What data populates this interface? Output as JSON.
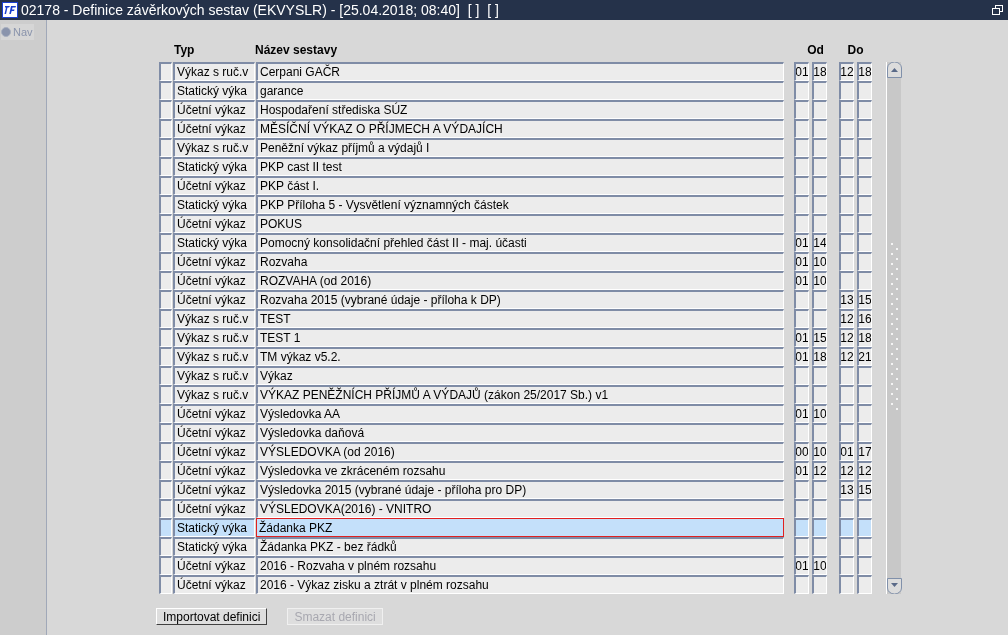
{
  "window": {
    "title": "02178 - Definice závěrkových sestav (EKVYSLR) - [25.04.2018; 08:40]  [ ]  [ ]"
  },
  "nav": {
    "label": "Nav",
    "selected": false
  },
  "table": {
    "columns": [
      "Typ",
      "Název sestavy",
      "Od",
      "Do"
    ],
    "rows": [
      {
        "type": "Výkaz s ruč.v",
        "name": "Cerpani GAČR",
        "od": [
          "01",
          "18"
        ],
        "do": [
          "12",
          "18"
        ],
        "selected": false
      },
      {
        "type": "Statický výka",
        "name": "garance",
        "selected": false
      },
      {
        "type": "Účetní výkaz",
        "name": "Hospodaření střediska SÚZ",
        "selected": false
      },
      {
        "type": "Účetní výkaz",
        "name": "MĚSÍČNÍ VÝKAZ O PŘÍJMECH A VÝDAJÍCH",
        "selected": false
      },
      {
        "type": "Výkaz s ruč.v",
        "name": "Peněžní výkaz příjmů a výdajů I",
        "selected": false
      },
      {
        "type": "Statický výka",
        "name": "PKP cast II test",
        "selected": false
      },
      {
        "type": "Účetní výkaz",
        "name": "PKP část I.",
        "selected": false
      },
      {
        "type": "Statický výka",
        "name": "PKP Příloha 5 - Vysvětlení významných částek",
        "selected": false
      },
      {
        "type": "Účetní výkaz",
        "name": "POKUS",
        "selected": false
      },
      {
        "type": "Statický výka",
        "name": "Pomocný konsolidační přehled část II - maj. účasti",
        "od": [
          "01",
          "14"
        ],
        "selected": false
      },
      {
        "type": "Účetní výkaz",
        "name": "Rozvaha",
        "od": [
          "01",
          "10"
        ],
        "selected": false
      },
      {
        "type": "Účetní výkaz",
        "name": "ROZVAHA (od 2016)",
        "od": [
          "01",
          "10"
        ],
        "selected": false
      },
      {
        "type": "Účetní výkaz",
        "name": "Rozvaha 2015 (vybrané údaje - příloha k DP)",
        "do": [
          "13",
          "15"
        ],
        "selected": false
      },
      {
        "type": "Výkaz s ruč.v",
        "name": "TEST",
        "do": [
          "12",
          "16"
        ],
        "selected": false
      },
      {
        "type": "Výkaz s ruč.v",
        "name": "TEST 1",
        "od": [
          "01",
          "15"
        ],
        "do": [
          "12",
          "18"
        ],
        "selected": false
      },
      {
        "type": "Výkaz s ruč.v",
        "name": "TM výkaz v5.2.",
        "od": [
          "01",
          "18"
        ],
        "do": [
          "12",
          "21"
        ],
        "selected": false
      },
      {
        "type": "Výkaz s ruč.v",
        "name": "Výkaz",
        "selected": false
      },
      {
        "type": "Výkaz s ruč.v",
        "name": "VÝKAZ PENĚŽNÍCH PŘÍJMŮ A VÝDAJŮ (zákon 25/2017 Sb.) v1",
        "selected": false
      },
      {
        "type": "Účetní výkaz",
        "name": "Výsledovka AA",
        "od": [
          "01",
          "10"
        ],
        "selected": false
      },
      {
        "type": "Účetní výkaz",
        "name": "Výsledovka daňová",
        "selected": false
      },
      {
        "type": "Účetní výkaz",
        "name": "VÝSLEDOVKA (od 2016)",
        "od": [
          "00",
          "10"
        ],
        "do": [
          "01",
          "17"
        ],
        "selected": false
      },
      {
        "type": "Účetní výkaz",
        "name": "Výsledovka ve zkráceném rozsahu",
        "od": [
          "01",
          "12"
        ],
        "do": [
          "12",
          "12"
        ],
        "selected": false
      },
      {
        "type": "Účetní výkaz",
        "name": "Výsledovka 2015 (vybrané údaje - příloha pro DP)",
        "do": [
          "13",
          "15"
        ],
        "selected": false
      },
      {
        "type": "Účetní výkaz",
        "name": "VÝSLEDOVKA(2016) - VNITRO",
        "selected": false
      },
      {
        "type": "Statický výka",
        "name": "Žádanka PKZ",
        "selected": true
      },
      {
        "type": "Statický výka",
        "name": "Žádanka PKZ - bez řádků",
        "selected": false
      },
      {
        "type": "Účetní výkaz",
        "name": "2016 - Rozvaha v plném rozsahu",
        "od": [
          "01",
          "10"
        ],
        "selected": false
      },
      {
        "type": "Účetní výkaz",
        "name": "2016 - Výkaz zisku a ztrát v plném rozsahu",
        "selected": false
      }
    ]
  },
  "buttons": [
    {
      "label": "Importovat definici",
      "disabled": false
    },
    {
      "label": "Smazat definici",
      "disabled": true
    }
  ]
}
